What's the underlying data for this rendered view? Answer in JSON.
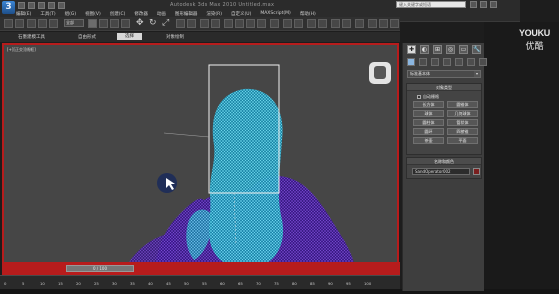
{
  "app": {
    "title_text": "Autodesk 3ds Max 2010    Untitled.max",
    "search_placeholder": "键入关键字或短语",
    "logo_letter": "3"
  },
  "menus": [
    "编辑(E)",
    "工具(T)",
    "组(G)",
    "视图(V)",
    "创建(C)",
    "修改器",
    "动画",
    "图形编辑器",
    "渲染(R)",
    "自定义(U)",
    "MAXScript(M)",
    "帮助(H)"
  ],
  "toolbar": {
    "selection_filter": "全部",
    "glyphs": [
      "✥",
      "↻",
      "⤢"
    ]
  },
  "ribbon": {
    "tabs": [
      {
        "label": "石墨建模工具"
      },
      {
        "label": "自由形式"
      },
      {
        "label": "选择"
      },
      {
        "label": "对象绘制"
      }
    ],
    "active_index": 2
  },
  "viewport": {
    "label": "[+][正交][线框]",
    "border_color": "#b71c1c",
    "mesh_color_cyan": "#2fb8d6",
    "mesh_color_violet": "#5a2bb0"
  },
  "timeline": {
    "slider_text": "0 / 100",
    "ticks": [
      "0",
      "5",
      "10",
      "15",
      "20",
      "25",
      "30",
      "35",
      "40",
      "45",
      "50",
      "55",
      "60",
      "65",
      "70",
      "75",
      "80",
      "85",
      "90",
      "95",
      "100"
    ]
  },
  "command_panel": {
    "tab_glyphs": [
      "✚",
      "◐",
      "⊞",
      "◎",
      "▭",
      "🔧"
    ],
    "category_dropdown": "标准基本体",
    "object_type": {
      "title": "对象类型",
      "autogrid_label": "自动栅格",
      "buttons": [
        "长方体",
        "圆锥体",
        "球体",
        "几何球体",
        "圆柱体",
        "管状体",
        "圆环",
        "四棱锥",
        "茶壶",
        "平面"
      ]
    },
    "name_color": {
      "title": "名称和颜色",
      "name_value": "SandOperator002",
      "color": "#7a1f1f"
    }
  },
  "watermark": {
    "brand": "YOUKU",
    "sub": "优酷"
  }
}
